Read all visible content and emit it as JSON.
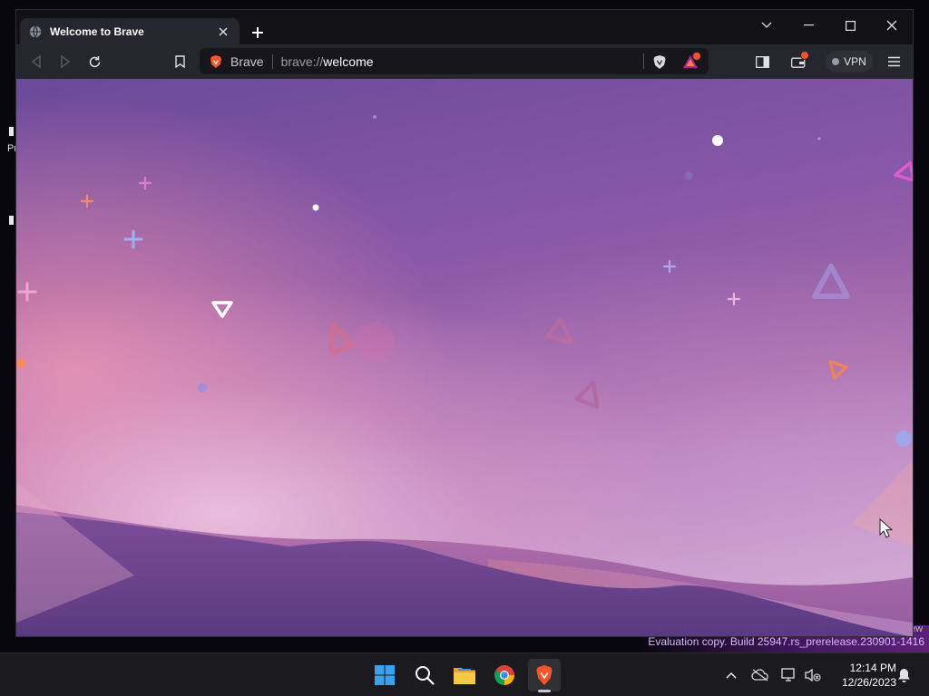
{
  "desktop": {
    "stub_label_left": "Pr",
    "stub_label_right": "ew",
    "evaluation_text": "Evaluation copy. Build 25947.rs_prerelease.230901-1416"
  },
  "browser": {
    "tab": {
      "title": "Welcome to Brave",
      "icon": "globe-icon"
    },
    "omnibox": {
      "brand": "Brave",
      "url_prefix": "brave://",
      "url_host": "welcome"
    },
    "vpn_label": "VPN"
  },
  "taskbar": {
    "apps": [
      "start-icon",
      "search-icon",
      "file-explorer-icon",
      "chrome-icon",
      "brave-icon"
    ],
    "clock_time": "12:14 PM",
    "clock_date": "12/26/2023"
  },
  "colors": {
    "brave_orange": "#fb542b",
    "accent_purple": "#7a52b0",
    "taskbar_bg": "#1b1b1f"
  }
}
